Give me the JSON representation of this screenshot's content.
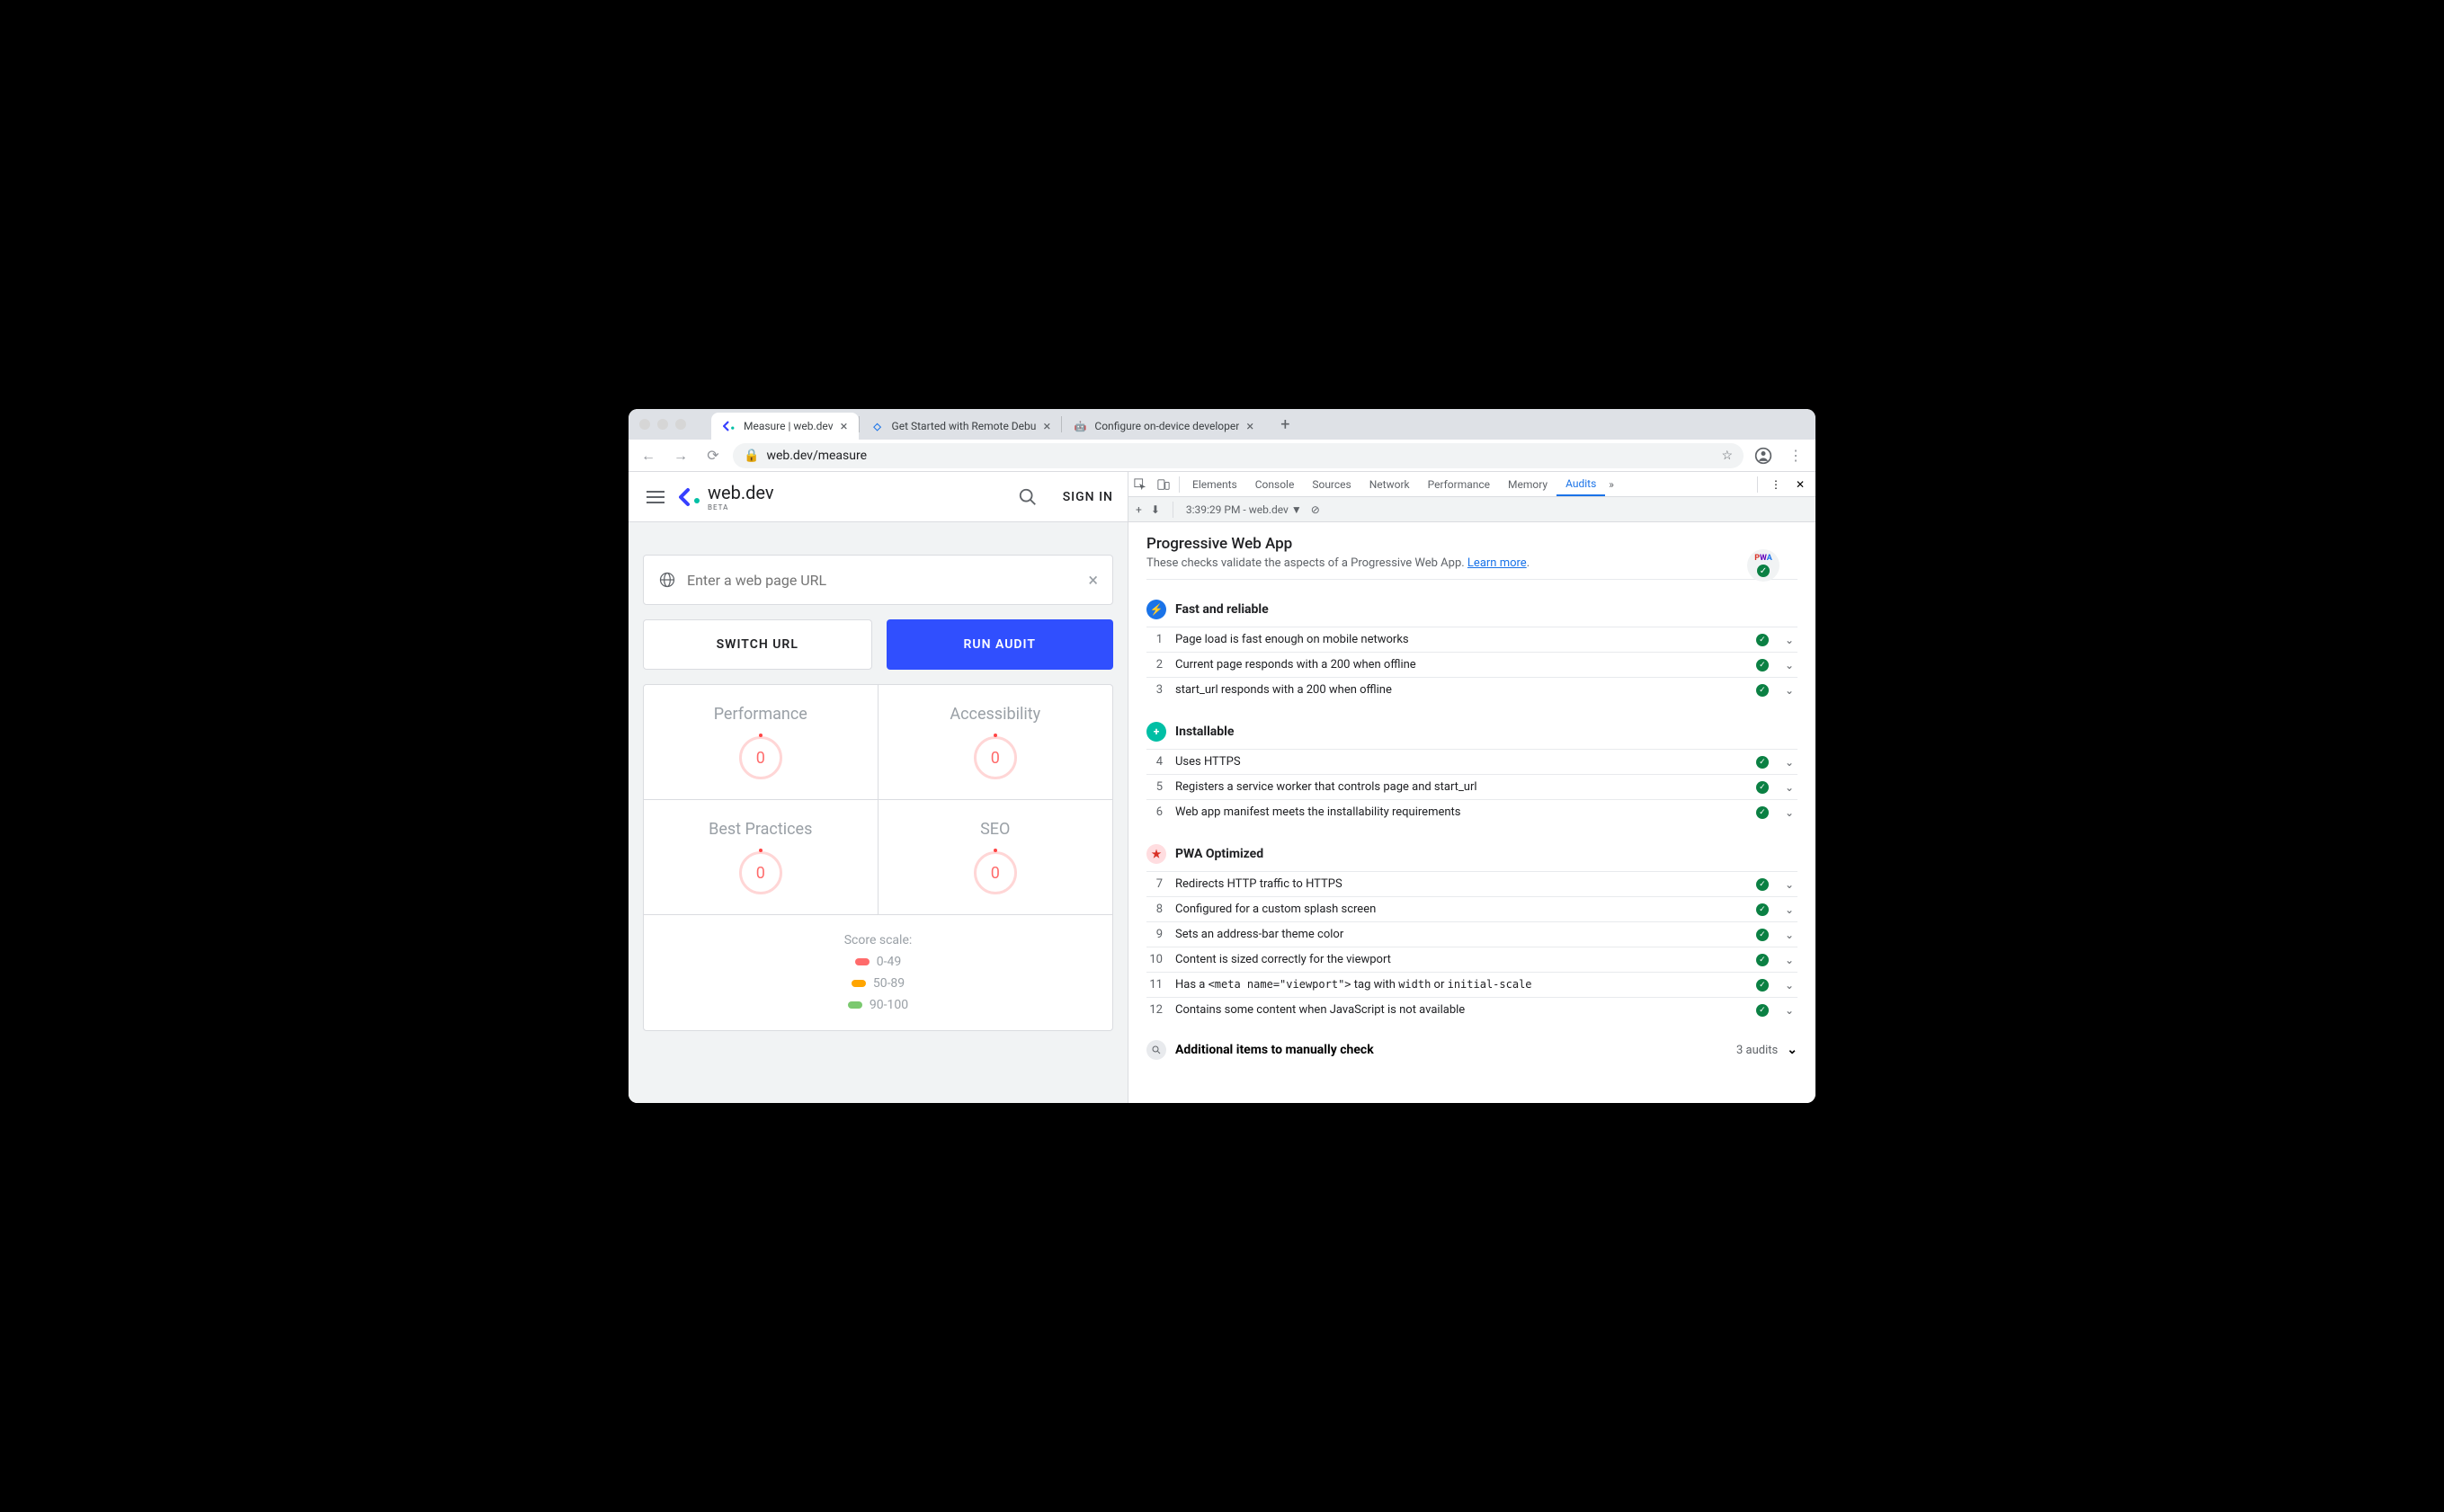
{
  "browser": {
    "tabs": [
      {
        "title": "Measure  |  web.dev",
        "active": true
      },
      {
        "title": "Get Started with Remote Debu",
        "active": false
      },
      {
        "title": "Configure on-device developer",
        "active": false
      }
    ],
    "url": "web.dev/measure"
  },
  "site": {
    "logo_text": "web.dev",
    "logo_beta": "BETA",
    "signin": "SIGN IN",
    "url_placeholder": "Enter a web page URL",
    "btn_switch": "SWITCH URL",
    "btn_run": "RUN AUDIT",
    "scores": [
      {
        "label": "Performance",
        "value": "0"
      },
      {
        "label": "Accessibility",
        "value": "0"
      },
      {
        "label": "Best Practices",
        "value": "0"
      },
      {
        "label": "SEO",
        "value": "0"
      }
    ],
    "scale_label": "Score scale:",
    "scale": [
      "0-49",
      "50-89",
      "90-100"
    ]
  },
  "devtools": {
    "tabs": [
      "Elements",
      "Console",
      "Sources",
      "Network",
      "Performance",
      "Memory",
      "Audits"
    ],
    "active_tab": "Audits",
    "toolbar_text": "3:39:29 PM - web.dev  ▼",
    "title": "Progressive Web App",
    "subtitle": "These checks validate the aspects of a Progressive Web App. ",
    "learn_more": "Learn more",
    "pwa_badge_text": "PWA",
    "sections": [
      {
        "icon": "blue",
        "title": "Fast and reliable",
        "items": [
          {
            "n": "1",
            "t": "Page load is fast enough on mobile networks"
          },
          {
            "n": "2",
            "t": "Current page responds with a 200 when offline"
          },
          {
            "n": "3",
            "t": "start_url responds with a 200 when offline"
          }
        ]
      },
      {
        "icon": "teal",
        "title": "Installable",
        "items": [
          {
            "n": "4",
            "t": "Uses HTTPS"
          },
          {
            "n": "5",
            "t": "Registers a service worker that controls page and start_url"
          },
          {
            "n": "6",
            "t": "Web app manifest meets the installability requirements"
          }
        ]
      },
      {
        "icon": "red2",
        "title": "PWA Optimized",
        "items": [
          {
            "n": "7",
            "t": "Redirects HTTP traffic to HTTPS"
          },
          {
            "n": "8",
            "t": "Configured for a custom splash screen"
          },
          {
            "n": "9",
            "t": "Sets an address-bar theme color"
          },
          {
            "n": "10",
            "t": "Content is sized correctly for the viewport"
          },
          {
            "n": "11",
            "html": "Has a <code>&lt;meta name=\"viewport\"&gt;</code> tag with <code>width</code> or <code>initial-scale</code>"
          },
          {
            "n": "12",
            "t": "Contains some content when JavaScript is not available"
          }
        ]
      }
    ],
    "manual_title": "Additional items to manually check",
    "manual_count": "3 audits"
  }
}
